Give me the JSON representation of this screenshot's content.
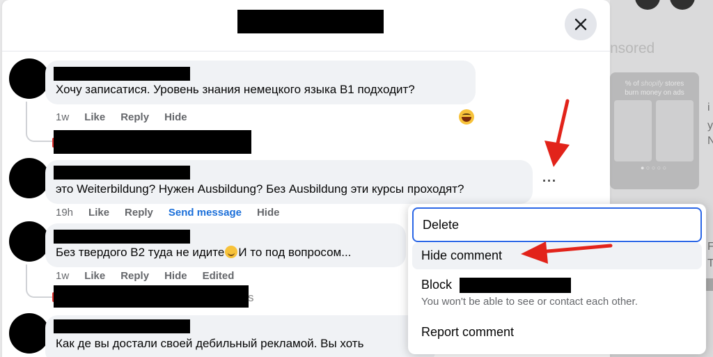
{
  "background": {
    "sponsored_fragment": "nsored",
    "ad": {
      "headline_pre": "% of",
      "brand": "shopify",
      "headline_post": "stores",
      "headline_line2": "burn money on ads"
    },
    "side_letters": [
      "i",
      "y",
      "N",
      "F",
      "T"
    ]
  },
  "modal": {
    "close_icon": "close-icon"
  },
  "comments": [
    {
      "text": "Хочу записатися. Уровень знания немецкого языка B1 подходит?",
      "time": "1w",
      "actions": [
        "Like",
        "Reply",
        "Hide"
      ],
      "reaction_icon": "grinning-emoji-icon"
    },
    {
      "text": "это Weiterbildung? Нужен Ausbildung? Без Ausbildung эти курсы проходят?",
      "time": "19h",
      "actions": [
        "Like",
        "Reply"
      ],
      "send_message": "Send message",
      "hide": "Hide",
      "more_label": "···"
    },
    {
      "text_before_emoji": "Без твердого B2 туда не идите",
      "emoji_icon": "smiling-emoji-icon",
      "text_after_emoji": "И то под вопросом...",
      "time": "1w",
      "actions": [
        "Like",
        "Reply",
        "Hide",
        "Edited"
      ],
      "reply_fragment": "s"
    },
    {
      "text": "Как де вы достали своей дебильный рекламой. Вы хоть"
    }
  ],
  "context_menu": {
    "items": [
      {
        "label": "Delete"
      },
      {
        "label": "Hide comment"
      },
      {
        "label": "Block",
        "sublabel": "You won't be able to see or contact each other."
      },
      {
        "label": "Report comment"
      }
    ]
  },
  "annotation_color": "#e2231a",
  "accent_blue": "#1b6fd9",
  "focus_blue": "#2a66e6"
}
